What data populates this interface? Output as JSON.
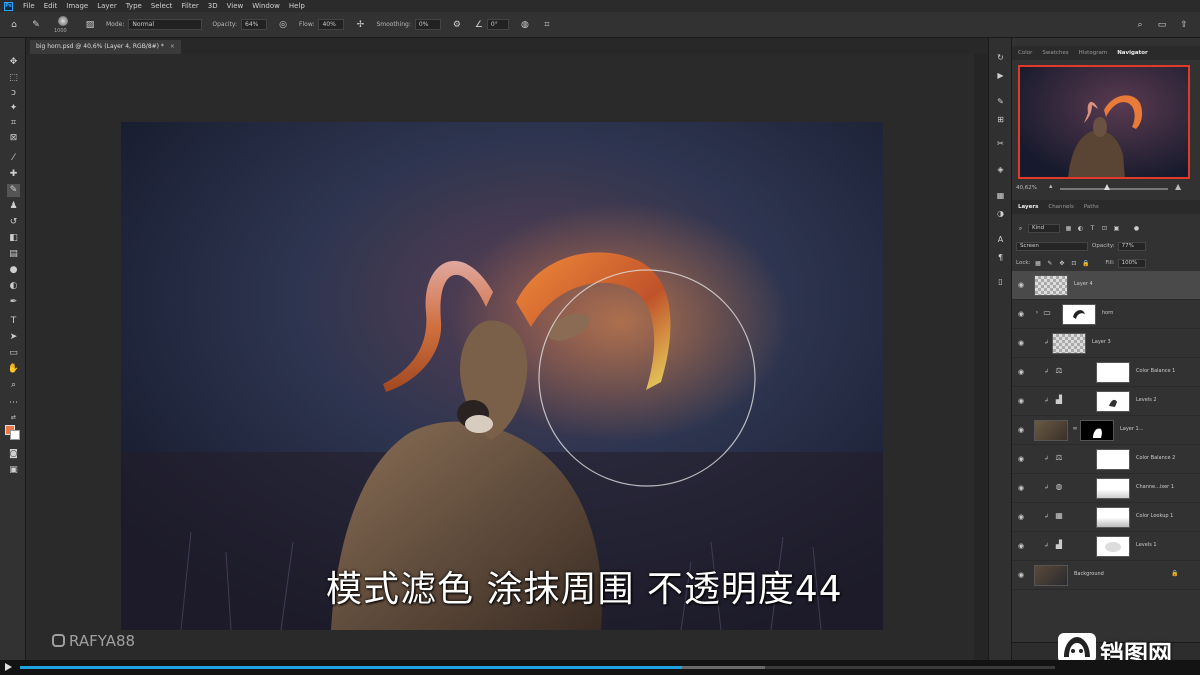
{
  "menu": {
    "app_icon": "Ps",
    "items": [
      "File",
      "Edit",
      "Image",
      "Layer",
      "Type",
      "Select",
      "Filter",
      "3D",
      "View",
      "Window",
      "Help"
    ]
  },
  "options": {
    "brush_size": "1000",
    "mode_label": "Mode:",
    "mode_value": "Normal",
    "opacity_label": "Opacity:",
    "opacity_value": "64%",
    "flow_label": "Flow:",
    "flow_value": "40%",
    "smoothing_label": "Smoothing:",
    "smoothing_value": "0%",
    "angle_value": "0°"
  },
  "document": {
    "tab_title": "big horn.psd @ 40,6% (Layer 4, RGB/8#) *",
    "tab_close": "×"
  },
  "navigator": {
    "tabs": [
      "Color",
      "Swatches",
      "Histogram",
      "Navigator"
    ],
    "zoom": "40,62%"
  },
  "layers_panel": {
    "tabs": [
      "Layers",
      "Channels",
      "Paths"
    ],
    "filter_kind": "Kind",
    "blend_mode": "Screen",
    "opacity_label": "Opacity:",
    "opacity_value": "77%",
    "lock_label": "Lock:",
    "fill_label": "Fill:",
    "fill_value": "100%",
    "layers": [
      {
        "name": "Layer 4",
        "selected": true
      },
      {
        "name": "horn",
        "type": "group"
      },
      {
        "name": "Layer 3"
      },
      {
        "name": "Color Balance 1",
        "type": "adjustment",
        "icon": "color-balance-icon"
      },
      {
        "name": "Levels 2",
        "type": "adjustment",
        "icon": "levels-icon"
      },
      {
        "name": "Layer 1...",
        "type": "masked"
      },
      {
        "name": "Color Balance 2",
        "type": "adjustment",
        "icon": "color-balance-icon"
      },
      {
        "name": "Channe...ixer 1",
        "type": "adjustment",
        "icon": "channel-mixer-icon"
      },
      {
        "name": "Color Lookup 1",
        "type": "adjustment",
        "icon": "color-lookup-icon"
      },
      {
        "name": "Levels 1",
        "type": "adjustment",
        "icon": "levels-icon"
      },
      {
        "name": "Background",
        "locked": true
      }
    ]
  },
  "overlay": {
    "subtitle": "模式滤色 涂抹周围 不透明度44",
    "watermark": "RAFYA88",
    "site_logo": "铛图网"
  },
  "video": {
    "progress": 0.64,
    "buffered": 0.72
  },
  "colors": {
    "foreground": "#e8774a",
    "background": "#ffffff",
    "progress_accent": "#1fa3e0",
    "navigator_frame": "#e23a2a"
  }
}
